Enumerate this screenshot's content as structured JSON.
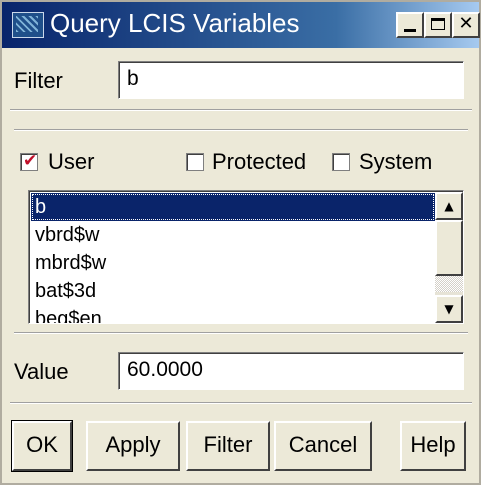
{
  "window": {
    "title": "Query LCIS Variables"
  },
  "filter": {
    "label": "Filter",
    "value": "b"
  },
  "checkboxes": [
    {
      "label": "User",
      "checked": true
    },
    {
      "label": "Protected",
      "checked": false
    },
    {
      "label": "System",
      "checked": false
    }
  ],
  "variables": [
    "b",
    "vbrd$w",
    "mbrd$w",
    "bat$3d",
    "beg$en"
  ],
  "selected_variable": "b",
  "value": {
    "label": "Value",
    "value": "60.0000"
  },
  "buttons": {
    "ok": "OK",
    "apply": "Apply",
    "filter": "Filter",
    "cancel": "Cancel",
    "help": "Help"
  },
  "colors": {
    "title_bar": "#08246b",
    "selection": "#0a246a",
    "checkmark": "#c0102a",
    "face": "#ece9d8"
  }
}
